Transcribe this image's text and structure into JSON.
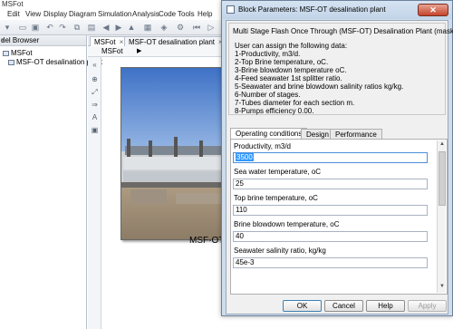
{
  "app": {
    "title": "MSFot",
    "menu": [
      "Edit",
      "View",
      "Display",
      "Diagram",
      "Simulation",
      "Analysis",
      "Code",
      "Tools",
      "Help"
    ],
    "left_panel": {
      "header": "del Browser",
      "close": "×",
      "items": [
        "MSFot",
        "MSF-OT desalination plant"
      ]
    },
    "tabs": [
      {
        "label": "MSFot",
        "close": "×"
      },
      {
        "label": "MSF-OT desalination plant",
        "close": "×"
      }
    ],
    "address": "MSFot",
    "address_arrow": "▶",
    "block_label": "MSF-OT"
  },
  "dialog": {
    "title": "Block Parameters: MSF-OT desalination plant",
    "close": "✕",
    "group_title": "Multi Stage Flash Once Through (MSF-OT) Desalination Plant (mask",
    "description": [
      "User can assign the following data:",
      "1-Productivity, m3/d.",
      "2-Top Brine temperature, oC.",
      "3-Brine blowdown temperature oC.",
      "4-Feed seawater 1st splitter ratio.",
      "5-Seawater and brine blowdown salinity ratios kg/kg.",
      "6-Number of stages.",
      "7-Tubes diameter for each section m.",
      "8-Pumps efficiency 0.00."
    ],
    "tabs": [
      "Operating conditions",
      "Design",
      "Performance"
    ],
    "params": [
      {
        "label": "Productivity, m3/d",
        "value": "3500"
      },
      {
        "label": "Sea water temperature, oC",
        "value": "25"
      },
      {
        "label": "Top brine temperature, oC",
        "value": "110"
      },
      {
        "label": "Brine blowdown temperature, oC",
        "value": "40"
      },
      {
        "label": "Seawater salinity ratio, kg/kg",
        "value": "45e-3"
      }
    ],
    "buttons": {
      "ok": "OK",
      "cancel": "Cancel",
      "help": "Help",
      "apply": "Apply"
    }
  }
}
